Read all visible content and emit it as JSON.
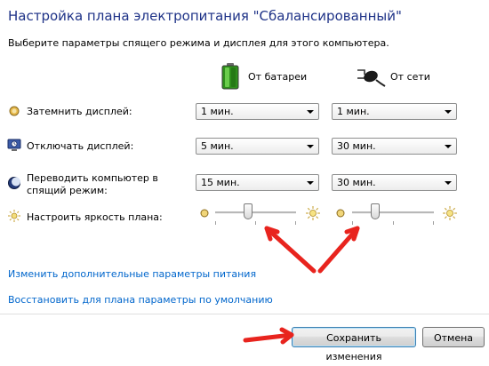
{
  "header": {
    "title": "Настройка плана электропитания \"Сбалансированный\"",
    "subtitle": "Выберите параметры спящего режима и дисплея для этого компьютера."
  },
  "columns": {
    "battery_label": "От батареи",
    "ac_label": "От сети",
    "battery_icon": "battery-icon",
    "ac_icon": "power-plug-icon"
  },
  "settings": [
    {
      "label": "Затемнить дисплей:",
      "icon": "dim-display-icon",
      "battery": "1 мин.",
      "ac": "1 мин."
    },
    {
      "label": "Отключать дисплей:",
      "icon": "display-off-icon",
      "battery": "5 мин.",
      "ac": "30 мин."
    },
    {
      "label": "Переводить компьютер в спящий режим:",
      "icon": "sleep-icon",
      "battery": "15 мин.",
      "ac": "30 мин."
    }
  ],
  "brightness": {
    "label": "Настроить яркость плана:",
    "battery_level": 0.4,
    "ac_level": 0.25
  },
  "links": {
    "advanced": "Изменить дополнительные параметры питания",
    "restore": "Восстановить для плана параметры по умолчанию"
  },
  "buttons": {
    "save": "Сохранить изменения",
    "cancel": "Отмена"
  },
  "colors": {
    "title": "#1e3287",
    "link": "#0066cc",
    "annotation_arrow": "#e8241e"
  }
}
